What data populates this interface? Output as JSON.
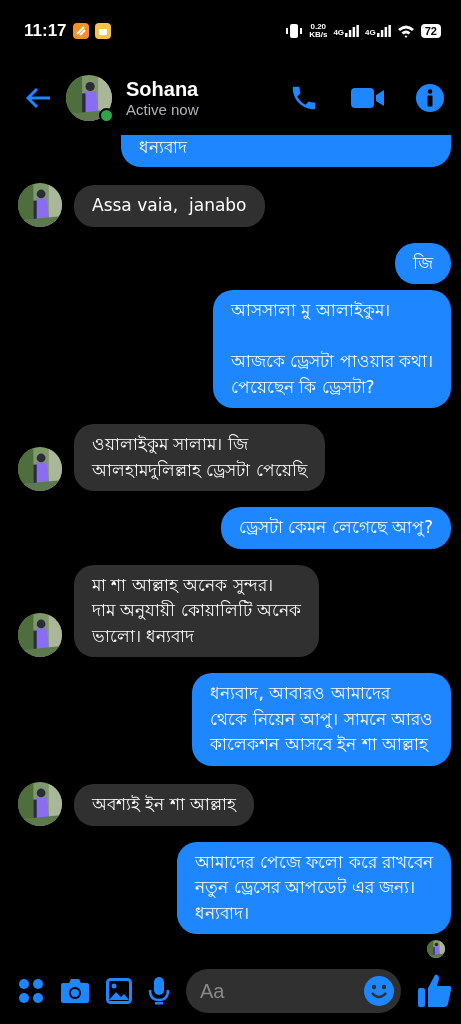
{
  "status_bar": {
    "time": "11:17",
    "speed_value": "0.20",
    "speed_unit": "KB/s",
    "networks": [
      "4G",
      "4G"
    ],
    "battery": "72"
  },
  "header": {
    "name": "Sohana",
    "status": "Active now",
    "online": true
  },
  "messages": [
    {
      "outgoing": true,
      "kind": "cut",
      "text": "ধন্যবাদ"
    },
    {
      "outgoing": false,
      "kind": "full",
      "text": "Assa vaia,  janabo"
    },
    {
      "outgoing": true,
      "kind": "full",
      "text": "জি"
    },
    {
      "outgoing": true,
      "kind": "full",
      "text": "আসসালা মু আলাইকুম।\n\nআজকে ড্রেসটা পাওয়ার কথা।\nপেয়েছেন কি ড্রেসটা?"
    },
    {
      "outgoing": false,
      "kind": "full",
      "text": "ওয়ালাইকুম সালাম। জি\nআলহামদুলিল্লাহ ড্রেসটা পেয়েছি"
    },
    {
      "outgoing": true,
      "kind": "full",
      "text": "ড্রেসটা কেমন লেগেছে আপু?"
    },
    {
      "outgoing": false,
      "kind": "full",
      "text": "মা শা আল্লাহ অনেক সুন্দর।\nদাম অনুযায়ী কোয়ালিটি অনেক\nভালো। ধন্যবাদ"
    },
    {
      "outgoing": true,
      "kind": "full",
      "text": "ধন্যবাদ, আবারও আমাদের\nথেকে নিয়েন আপু। সামনে আরও\nকালেকশন আসবে ইন শা আল্লাহ"
    },
    {
      "outgoing": false,
      "kind": "full",
      "text": "অবশ্যই ইন শা আল্লাহ"
    },
    {
      "outgoing": true,
      "kind": "full",
      "text": "আমাদের পেজে ফলো করে রাখবেন\nনতুন ড্রেসের আপডেট এর জন্য।\nধন্যবাদ।"
    }
  ],
  "seen": true,
  "composer": {
    "placeholder": "Aa"
  }
}
